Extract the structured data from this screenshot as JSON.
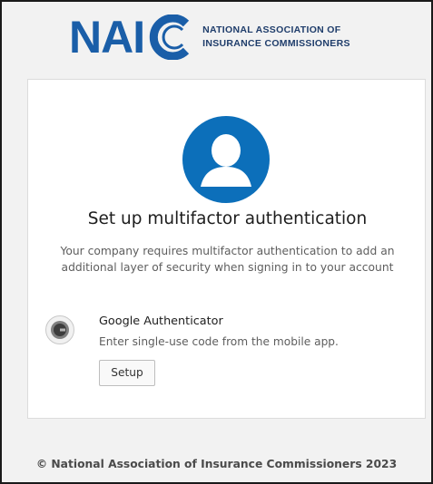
{
  "brand": {
    "logo_letters": "NAI",
    "logo_line1": "NATIONAL ASSOCIATION OF",
    "logo_line2": "INSURANCE COMMISSIONERS",
    "primary_color": "#1a5ea8",
    "avatar_color": "#0c6fba"
  },
  "card": {
    "avatar_icon": "user-avatar-icon",
    "title": "Set up multifactor authentication",
    "description": "Your company requires multifactor authentication to add an additional layer of security when signing in to your account",
    "factors": [
      {
        "icon": "google-authenticator-icon",
        "name": "Google Authenticator",
        "description": "Enter single-use code from the mobile app.",
        "button_label": "Setup"
      }
    ]
  },
  "footer": {
    "text": "© National Association of Insurance Commissioners 2023"
  }
}
